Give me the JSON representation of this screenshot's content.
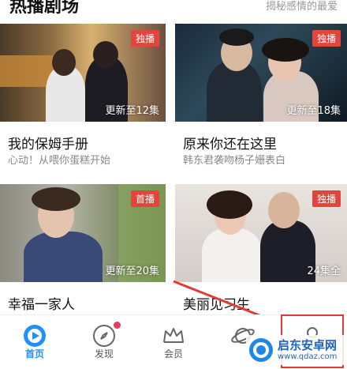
{
  "section": {
    "title": "热播剧场",
    "subtitle": "揭秘感情的最爱"
  },
  "cards": [
    {
      "tag": "独播",
      "episodes": "更新至12集",
      "title": "我的保姆手册",
      "subtitle": "心动！从喂你蛋糕开始",
      "tag_color": "#e0463c"
    },
    {
      "tag": "独播",
      "episodes": "更新至18集",
      "title": "原来你还在这里",
      "subtitle": "韩东君袭吻杨子姗表白",
      "tag_color": "#e0463c"
    },
    {
      "tag": "首播",
      "episodes": "更新至20集",
      "title": "幸福一家人",
      "subtitle": "",
      "tag_color": "#e0463c"
    },
    {
      "tag": "独播",
      "episodes": "24集全",
      "title": "美丽见习生",
      "subtitle": "",
      "tag_color": "#e0463c"
    }
  ],
  "nav": [
    {
      "label": "首页",
      "icon": "home-play-icon",
      "active": true
    },
    {
      "label": "发现",
      "icon": "compass-icon",
      "badge": true
    },
    {
      "label": "会员",
      "icon": "crown-icon"
    },
    {
      "label": "",
      "icon": "planet-icon"
    },
    {
      "label": "",
      "icon": "person-icon"
    }
  ],
  "watermark": {
    "text": "启东安卓网",
    "url": "www.qdaz.com"
  },
  "colors": {
    "accent": "#1e90ff",
    "tag": "#e0463c",
    "highlight": "#e23a36"
  }
}
